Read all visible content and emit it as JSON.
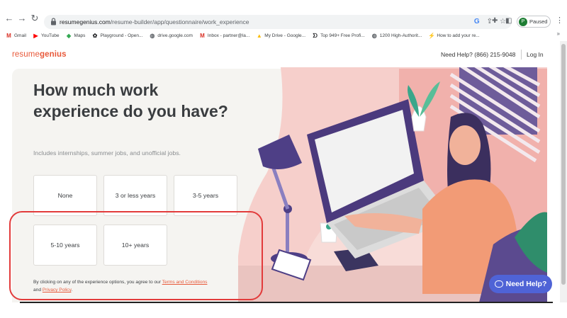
{
  "browser": {
    "url_domain": "resumegenius.com",
    "url_path": "/resume-builder/app/questionnaire/work_experience",
    "profile_initial": "P",
    "profile_status": "Paused",
    "bookmarks": [
      {
        "label": "Gmail",
        "icon": "gmail-icon",
        "color": "#d93025",
        "glyph": "M"
      },
      {
        "label": "YouTube",
        "icon": "youtube-icon",
        "color": "#ff0000",
        "glyph": "▶"
      },
      {
        "label": "Maps",
        "icon": "maps-icon",
        "color": "#34a853",
        "glyph": "◆"
      },
      {
        "label": "Playground - Open...",
        "icon": "openai-icon",
        "color": "#202124",
        "glyph": "✿"
      },
      {
        "label": "drive.google.com",
        "icon": "globe-icon",
        "color": "#5f6368",
        "glyph": "◍"
      },
      {
        "label": "Inbox - partner@la...",
        "icon": "gmail-icon",
        "color": "#d93025",
        "glyph": "M"
      },
      {
        "label": "My Drive - Google...",
        "icon": "drive-icon",
        "color": "#fbbc04",
        "glyph": "▲"
      },
      {
        "label": "Top 949+ Free Profi...",
        "icon": "profile-site-icon",
        "color": "#202124",
        "glyph": "ᗤ"
      },
      {
        "label": "1200 High-Authorit...",
        "icon": "globe-icon",
        "color": "#5f6368",
        "glyph": "◍"
      },
      {
        "label": "How to add your re...",
        "icon": "bolt-icon",
        "color": "#1e8e3e",
        "glyph": "⚡"
      }
    ]
  },
  "header": {
    "logo_part1": "resume",
    "logo_part2": "genius",
    "help_phone": "Need Help? (866) 215-9048",
    "login": "Log In"
  },
  "question": {
    "title": "How much work experience do you have?",
    "subtitle": "Includes internships, summer jobs, and unofficial jobs.",
    "options": [
      "None",
      "3 or less years",
      "3-5 years",
      "5-10 years",
      "10+ years"
    ]
  },
  "legal": {
    "prefix": "By clicking on any of the experience options, you agree to our ",
    "terms": "Terms and Conditions",
    "middle": " and ",
    "privacy": "Privacy Policy",
    "suffix": "."
  },
  "chat": {
    "label": "Need Help?"
  },
  "colors": {
    "brand": "#e8593a",
    "chat": "#4f63d6",
    "annotation": "#e23b3b"
  }
}
